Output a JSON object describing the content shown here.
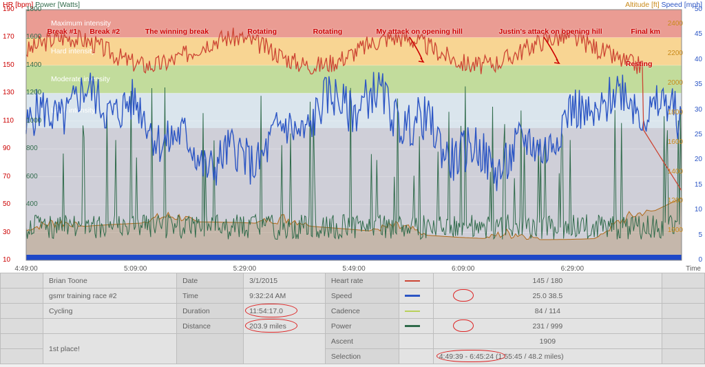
{
  "chart_data": {
    "type": "line",
    "title_tl_hr": "HR [bpm]",
    "title_tl_pw": "Power [Watts]",
    "title_tr_alt": "Altitude [ft]",
    "title_tr_spd": "Speed [mph]",
    "x_label": "Time",
    "x_ticks": [
      "4:49:00",
      "5:09:00",
      "5:29:00",
      "5:49:00",
      "6:09:00",
      "6:29:00"
    ],
    "hr_axis": {
      "min": 10,
      "max": 190,
      "step": 20
    },
    "pwr_axis": {
      "ticks": [
        400,
        600,
        800,
        1000,
        1200,
        1400,
        1600,
        1800
      ]
    },
    "alt_axis": {
      "ticks": [
        1000,
        1200,
        1400,
        1600,
        1800,
        2000,
        2200,
        2400
      ]
    },
    "spd_axis": {
      "min": 0,
      "max": 50,
      "step": 5
    },
    "zones": [
      {
        "label": "Maximum intensity",
        "from": 170,
        "to": 190,
        "color": "#d94a3a"
      },
      {
        "label": "Hard intensity",
        "from": 150,
        "to": 170,
        "color": "#f3b23a"
      },
      {
        "label": "Moderate intensity",
        "from": 130,
        "to": 150,
        "color": "#8fbf4a"
      },
      {
        "label": "Light intensity",
        "from": 105,
        "to": 130,
        "color": "#bcd0de"
      },
      {
        "label": "",
        "from": 10,
        "to": 105,
        "color": "#a8a8b8"
      }
    ],
    "annotations": [
      {
        "text": "Break #1",
        "x": 0.055
      },
      {
        "text": "Break #2",
        "x": 0.12
      },
      {
        "text": "The winning break",
        "x": 0.23
      },
      {
        "text": "Rotating",
        "x": 0.36
      },
      {
        "text": "Rotating",
        "x": 0.46
      },
      {
        "text": "My attack on opening hill",
        "x": 0.6
      },
      {
        "text": "Justin's attack on opening hill",
        "x": 0.8
      },
      {
        "text": "Final km",
        "x": 0.945
      },
      {
        "text": "Resting",
        "x": 0.935,
        "y": 0.2
      }
    ],
    "series_colors": {
      "hr": "#cc4433",
      "power": "#2f6a4a",
      "speed": "#2b55c4",
      "altitude": "#c98a1a"
    }
  },
  "stats": {
    "athlete": "Brian Toone",
    "event": "gsmr training race #2",
    "sport": "Cycling",
    "note": "1st place!",
    "date_lbl": "Date",
    "date": "3/1/2015",
    "time_lbl": "Time",
    "time": "9:32:24 AM",
    "duration_lbl": "Duration",
    "duration": "11:54:17.0",
    "distance_lbl": "Distance",
    "distance": "203.9 miles",
    "hr_lbl": "Heart rate",
    "hr": "145 / 180",
    "spd_lbl": "Speed",
    "spd_a": "25.0",
    "spd_b": "  38.5",
    "cad_lbl": "Cadence",
    "cad": "84 / 114",
    "pwr_lbl": "Power",
    "pwr_a": "231",
    "pwr_b": " / 999",
    "asc_lbl": "Ascent",
    "asc": "1909",
    "sel_lbl": "Selection",
    "sel_a": "4:49:39 - 6:45:24",
    "sel_b": " (1:55:45 / 48.2 miles)"
  }
}
